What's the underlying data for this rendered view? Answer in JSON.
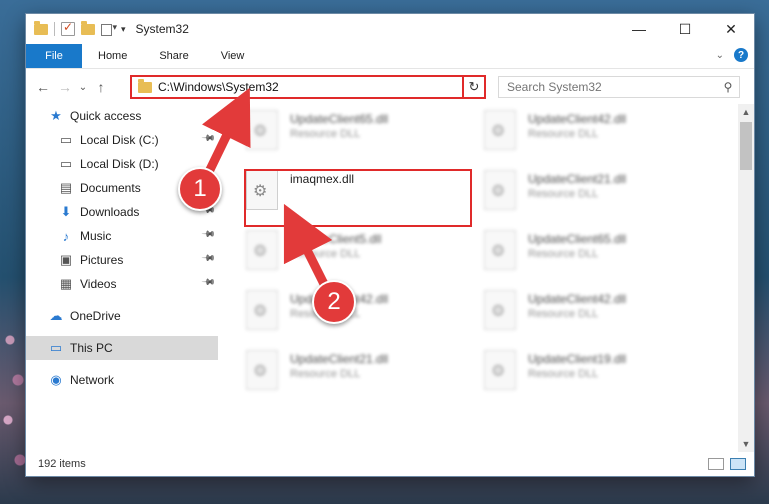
{
  "window": {
    "title": "System32"
  },
  "ribbon": {
    "tabs": [
      "File",
      "Home",
      "Share",
      "View"
    ]
  },
  "address": {
    "path": "C:\\Windows\\System32"
  },
  "search": {
    "placeholder": "Search System32"
  },
  "sidebar": {
    "items": [
      {
        "label": "Quick access",
        "icon": "star-icon",
        "level": "top"
      },
      {
        "label": "Local Disk (C:)",
        "icon": "drive-icon",
        "level": "sub",
        "pinned": true
      },
      {
        "label": "Local Disk (D:)",
        "icon": "drive-icon",
        "level": "sub",
        "pinned": false
      },
      {
        "label": "Documents",
        "icon": "documents-icon",
        "level": "sub",
        "pinned": true
      },
      {
        "label": "Downloads",
        "icon": "download-icon",
        "level": "sub",
        "pinned": true
      },
      {
        "label": "Music",
        "icon": "music-icon",
        "level": "sub",
        "pinned": true
      },
      {
        "label": "Pictures",
        "icon": "pictures-icon",
        "level": "sub",
        "pinned": true
      },
      {
        "label": "Videos",
        "icon": "videos-icon",
        "level": "sub",
        "pinned": true
      },
      {
        "label": "OneDrive",
        "icon": "cloud-icon",
        "level": "top"
      },
      {
        "label": "This PC",
        "icon": "pc-icon",
        "level": "top",
        "selected": true
      },
      {
        "label": "Network",
        "icon": "network-icon",
        "level": "top"
      }
    ]
  },
  "files": [
    {
      "name": "UpdateClient65.dll",
      "type": "Resource DLL",
      "col": 0,
      "row": 0,
      "blurred": true
    },
    {
      "name": "UpdateClient42.dll",
      "type": "Resource DLL",
      "col": 1,
      "row": 0,
      "blurred": true
    },
    {
      "name": "imaqmex.dll",
      "type": "",
      "col": 0,
      "row": 1,
      "blurred": false
    },
    {
      "name": "UpdateClient21.dll",
      "type": "Resource DLL",
      "col": 1,
      "row": 1,
      "blurred": true
    },
    {
      "name": "UpdateClient5.dll",
      "type": "Resource DLL",
      "col": 0,
      "row": 2,
      "blurred": true
    },
    {
      "name": "UpdateClient65.dll",
      "type": "Resource DLL",
      "col": 1,
      "row": 2,
      "blurred": true
    },
    {
      "name": "UpdateClient42.dll",
      "type": "Resource DLL",
      "col": 0,
      "row": 3,
      "blurred": true
    },
    {
      "name": "UpdateClient42.dll",
      "type": "Resource DLL",
      "col": 1,
      "row": 3,
      "blurred": true
    },
    {
      "name": "UpdateClient21.dll",
      "type": "Resource DLL",
      "col": 0,
      "row": 4,
      "blurred": true
    },
    {
      "name": "UpdateClient19.dll",
      "type": "Resource DLL",
      "col": 1,
      "row": 4,
      "blurred": true
    }
  ],
  "status": {
    "count": "192 items"
  },
  "callouts": [
    "1",
    "2"
  ],
  "colors": {
    "accent": "#1979ca",
    "highlight": "#e02a2a"
  }
}
